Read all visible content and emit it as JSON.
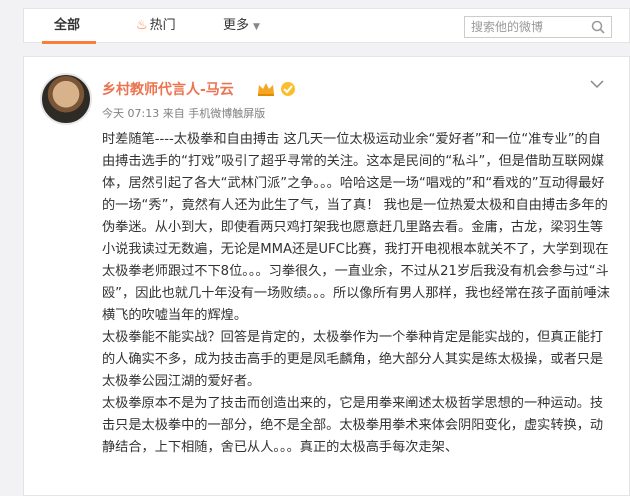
{
  "tabs": {
    "all": "全部",
    "hot": "热门",
    "more": "更多"
  },
  "search": {
    "placeholder": "搜索他的微博"
  },
  "post": {
    "username": "乡村教师代言人-马云",
    "meta": "今天 07:13 来自 手机微博触屏版",
    "paragraphs": [
      "时差随笔----太极拳和自由搏击 这几天一位太极运动业余“爱好者”和一位“准专业”的自由搏击选手的“打戏”吸引了超乎寻常的关注。这本是民间的“私斗”，但是借助互联网媒体，居然引起了各大“武林门派”之争。。。哈哈这是一场“唱戏的”和“看戏的”互动得最好的一场“秀”，竟然有人还为此生了气，当了真！ 我也是一位热爱太极和自由搏击多年的伪拳迷。从小到大，即使看两只鸡打架我也愿意赶几里路去看。金庸，古龙，梁羽生等小说我读过无数遍，无论是MMA还是UFC比赛，我打开电视根本就关不了，大学到现在太极拳老师跟过不下8位。。。习拳很久，一直业余，不过从21岁后我没有机会参与过“斗殴”，因此也就几十年没有一场败绩。。。所以像所有男人那样，我也经常在孩子面前唾沫横飞的吹嘘当年的辉煌。",
      "太极拳能不能实战？回答是肯定的，太极拳作为一个拳种肯定是能实战的，但真正能打的人确实不多，成为技击高手的更是凤毛麟角，绝大部分人其实是练太极操，或者只是太极拳公园江湖的爱好者。",
      "太极拳原本不是为了技击而创造出来的，它是用拳来阐述太极哲学思想的一种运动。技击只是太极拳中的一部分，绝不是全部。太极拳用拳术来体会阴阳变化，虚实转换，动静结合，上下相随，舍已从人。。。真正的太极高手每次走架、"
    ]
  },
  "colors": {
    "accent": "#fa7d3c",
    "username": "#eb7350",
    "meta": "#808080"
  },
  "icons": {
    "hot": "flame-icon",
    "more": "chevron-down-icon",
    "search": "search-icon",
    "vip": "vip-crown-icon",
    "verified": "verified-icon",
    "menu": "chevron-down-icon"
  }
}
